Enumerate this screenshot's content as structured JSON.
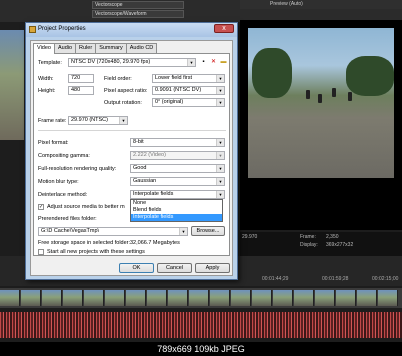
{
  "editor": {
    "top_combo_1": "Vectorscope",
    "top_combo_2": "Vectorscope/Waveform",
    "preview_label": "Preview (Auto)",
    "frame_label": "Frame:",
    "frame_value": "2,350",
    "display_label": "Display:",
    "display_value": "369x277x32",
    "timecode_left": "00:01:44;29",
    "timecode_mid": "00:01:59;28",
    "timecode_right": "00:02:15;00",
    "preview_rate": "29.970",
    "caption": "789x669  109kb  JPEG"
  },
  "dialog": {
    "title": "Project Properties",
    "close_label": "x",
    "tabs": [
      "Video",
      "Audio",
      "Ruler",
      "Summary",
      "Audio CD"
    ],
    "template_label": "Template:",
    "template_value": "NTSC DV (720x480, 29.970 fps)",
    "width_label": "Width:",
    "width_value": "720",
    "height_label": "Height:",
    "height_value": "480",
    "field_order_label": "Field order:",
    "field_order_value": "Lower field first",
    "pixel_aspect_label": "Pixel aspect ratio:",
    "pixel_aspect_value": "0.9091 (NTSC DV)",
    "output_rotation_label": "Output rotation:",
    "output_rotation_value": "0° (original)",
    "frame_rate_label": "Frame rate:",
    "frame_rate_value": "29.970 (NTSC)",
    "pixel_format_label": "Pixel format:",
    "pixel_format_value": "8-bit",
    "compositing_gamma_label": "Compositing gamma:",
    "compositing_gamma_value": "2.222 (Video)",
    "full_res_label": "Full-resolution rendering quality:",
    "full_res_value": "Good",
    "motion_blur_label": "Motion blur type:",
    "motion_blur_value": "Gaussian",
    "deinterlace_label": "Deinterlace method:",
    "deinterlace_value": "Interpolate fields",
    "deinterlace_options": [
      "None",
      "Blend fields",
      "Interpolate fields"
    ],
    "adjust_source_label": "Adjust source media to better m",
    "prerendered_label": "Prerendered files folder:",
    "prerendered_value": "G:\\D Cache\\VegasTmp\\",
    "browse_label": "Browse...",
    "free_storage_label": "Free storage space in selected folder:",
    "free_storage_value": "32,066.7 Megabytes",
    "start_all_label": "Start all new projects with these settings",
    "ok_label": "OK",
    "cancel_label": "Cancel",
    "apply_label": "Apply"
  }
}
